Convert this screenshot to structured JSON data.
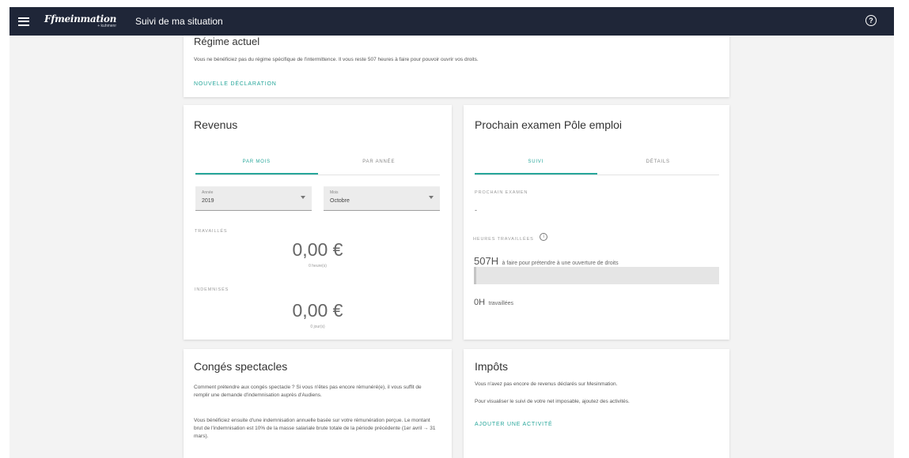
{
  "topbar": {
    "brand": "Ffmeinmation",
    "brand_sub": "+ kuhmenr",
    "title": "Suivi de ma situation"
  },
  "regime": {
    "title": "Régime actuel",
    "text": "Vous ne bénéficiez pas du régime spécifique de l'intermittence. Il vous reste 507 heures à faire pour pouvoir ouvrir vos droits.",
    "link": "NOUVELLE DÉCLARATION"
  },
  "revenus": {
    "title": "Revenus",
    "tabs": [
      "PAR MOIS",
      "PAR ANNÉE"
    ],
    "year_select": {
      "label": "Année",
      "value": "2019"
    },
    "month_select": {
      "label": "Mois",
      "value": "Octobre"
    },
    "travailles": {
      "label": "TRAVAILLÉS",
      "amount": "0,00 €",
      "sub": "0 heure(s)"
    },
    "indemnises": {
      "label": "INDEMNISÉS",
      "amount": "0,00 €",
      "sub": "0 jour(s)"
    }
  },
  "examen": {
    "title": "Prochain examen Pôle emploi",
    "tabs": [
      "SUIVI",
      "DÉTAILS"
    ],
    "next_label": "PROCHAIN EXAMEN",
    "next_value": "-",
    "hours_label": "HEURES TRAVAILLÉES",
    "remaining_value": "507H",
    "remaining_text": "à faire pour prétendre à une ouverture de droits",
    "progress": 0.01,
    "worked_value": "0H",
    "worked_text": "travaillées"
  },
  "conges": {
    "title": "Congés spectacles",
    "p1": "Comment prétendre aux congés spectacle ? Si vous n'êtes pas encore rémunéré(e), il vous suffit de remplir une demande d'indemnisation auprès d'Audiens.",
    "p2": "Vous bénéficiez ensuite d'une indemnisation annuelle basée sur votre rémunération perçue. Le montant brut de l'indemnisation est 10% de la masse salariale brute totale de la période précédente (1er avril → 31 mars)."
  },
  "impots": {
    "title": "Impôts",
    "p1": "Vous n'avez pas encore de revenus déclarés sur Mesinmation.",
    "p2": "Pour visualiser le suivi de votre net imposable, ajoutez des activités.",
    "link": "AJOUTER UNE ACTIVITÉ"
  },
  "colors": {
    "accent": "#26a69a",
    "topbar": "#1f2638"
  },
  "icons": {
    "menu": "menu-icon",
    "help": "help-icon",
    "info": "info-icon",
    "dropdown": "chevron-down-icon"
  }
}
